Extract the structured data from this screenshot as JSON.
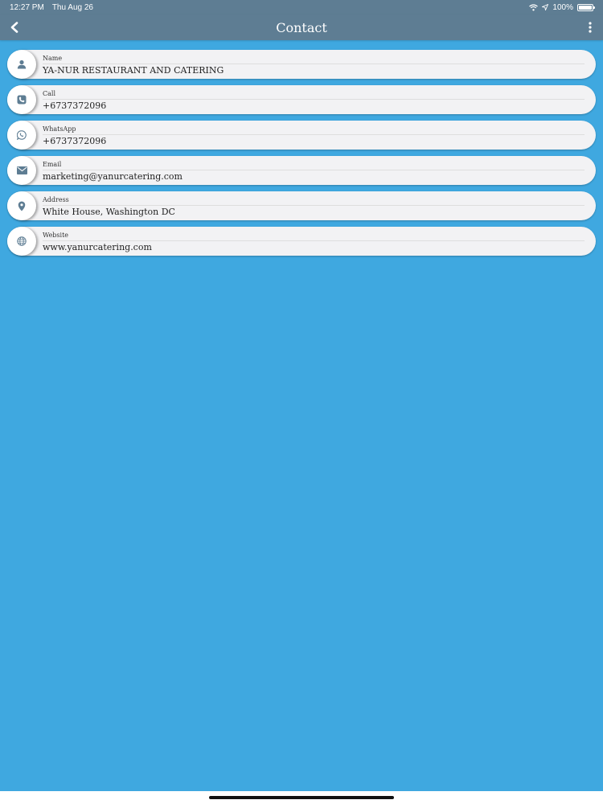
{
  "status": {
    "time": "12:27 PM",
    "date": "Thu Aug 26",
    "battery": "100%",
    "battery_level": 1.0
  },
  "nav": {
    "title": "Contact"
  },
  "contact": [
    {
      "label": "Name",
      "value": "YA-NUR RESTAURANT AND CATERING",
      "icon": "person-icon"
    },
    {
      "label": "Call",
      "value": "+6737372096",
      "icon": "phone-icon"
    },
    {
      "label": "WhatsApp",
      "value": "+6737372096",
      "icon": "whatsapp-icon"
    },
    {
      "label": "Email",
      "value": "marketing@yanurcatering.com",
      "icon": "envelope-icon"
    },
    {
      "label": "Address",
      "value": "White House, Washington DC",
      "icon": "map-pin-icon"
    },
    {
      "label": "Website",
      "value": "www.yanurcatering.com",
      "icon": "globe-icon"
    }
  ],
  "colors": {
    "background": "#3fa8e0",
    "bar": "#5e7d93",
    "row": "#f2f2f4",
    "icon": "#5e7d93"
  }
}
